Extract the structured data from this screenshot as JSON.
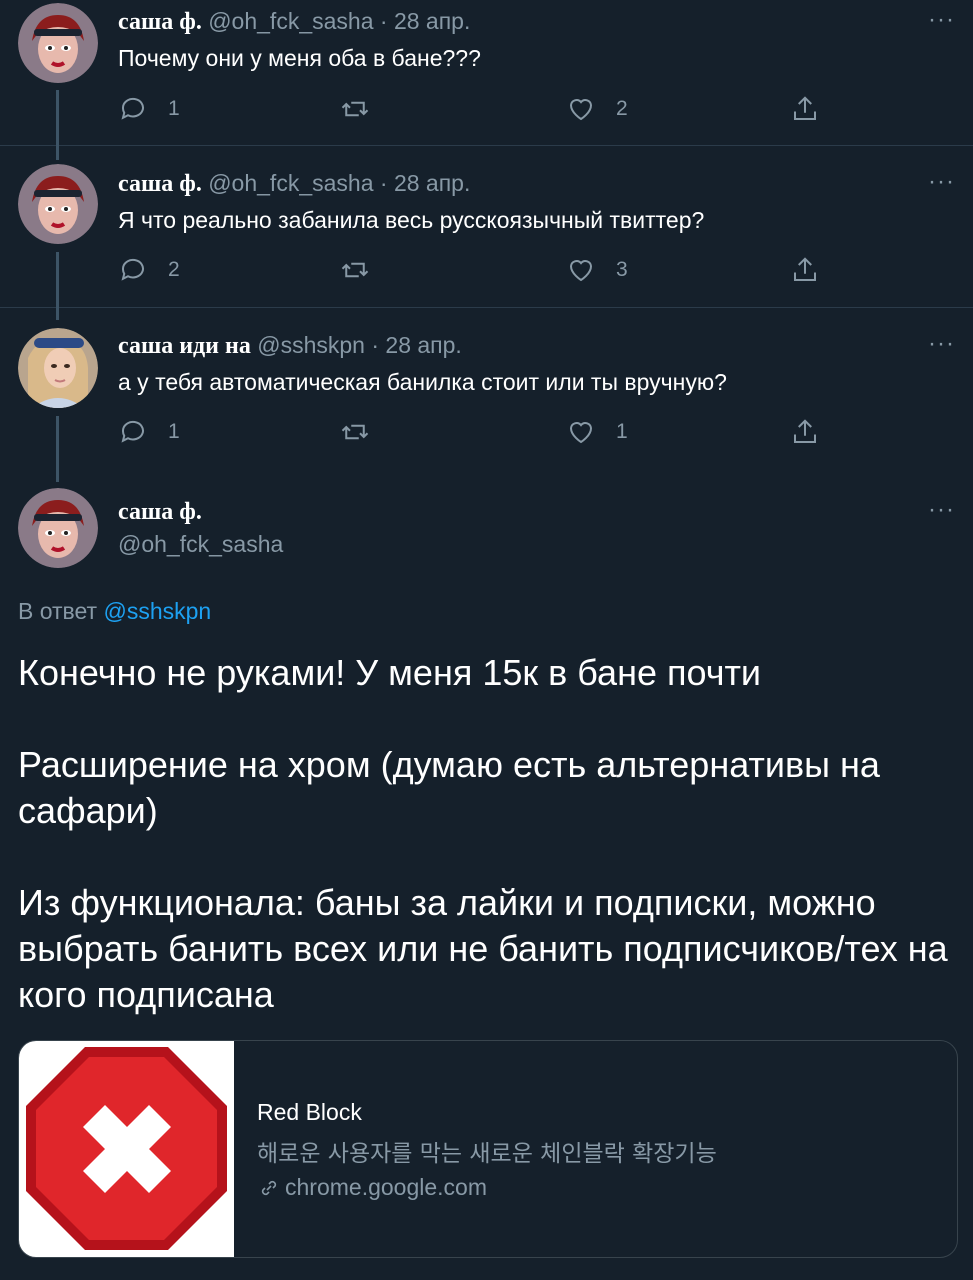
{
  "tweets": [
    {
      "name": "саша ф.",
      "handle": "@oh_fck_sasha",
      "date": "28 апр.",
      "separator": "·",
      "text": "Почему они у меня оба в бане???",
      "reply_count": "1",
      "retweet_count": "",
      "like_count": "2",
      "avatar_icon": "avatar-red-hair-icon"
    },
    {
      "name": "саша ф.",
      "handle": "@oh_fck_sasha",
      "date": "28 апр.",
      "separator": "·",
      "text": "Я что реально забанила весь русскоязычный твиттер?",
      "reply_count": "2",
      "retweet_count": "",
      "like_count": "3",
      "avatar_icon": "avatar-red-hair-icon"
    },
    {
      "name": "саша иди на",
      "handle": "@sshskpn",
      "date": "28 апр.",
      "separator": "·",
      "text": "а у тебя автоматическая банилка стоит или ты вручную?",
      "reply_count": "1",
      "retweet_count": "",
      "like_count": "1",
      "avatar_icon": "avatar-photo-blonde-icon"
    }
  ],
  "main_tweet": {
    "name": "саша ф.",
    "handle": "@oh_fck_sasha",
    "reply_label": "В ответ",
    "reply_mention": "@sshskpn",
    "paragraphs": [
      "Конечно не руками! У меня 15к в бане почти",
      "Расширение на хром (думаю есть альтернативы на сафари)",
      "Из функционала: баны за лайки и подписки, можно выбрать банить всех или не банить подписчиков/тех на кого подписана"
    ]
  },
  "link_card": {
    "title": "Red Block",
    "description": "해로운 사용자를 막는 새로운 체인블락 확장기능",
    "domain": "chrome.google.com",
    "image_icon": "red-stop-x-icon"
  },
  "more_label": "···",
  "colors": {
    "background": "#15202b",
    "secondary_text": "#8899a6",
    "link": "#1da1f2",
    "thread_line": "#3d5466"
  }
}
